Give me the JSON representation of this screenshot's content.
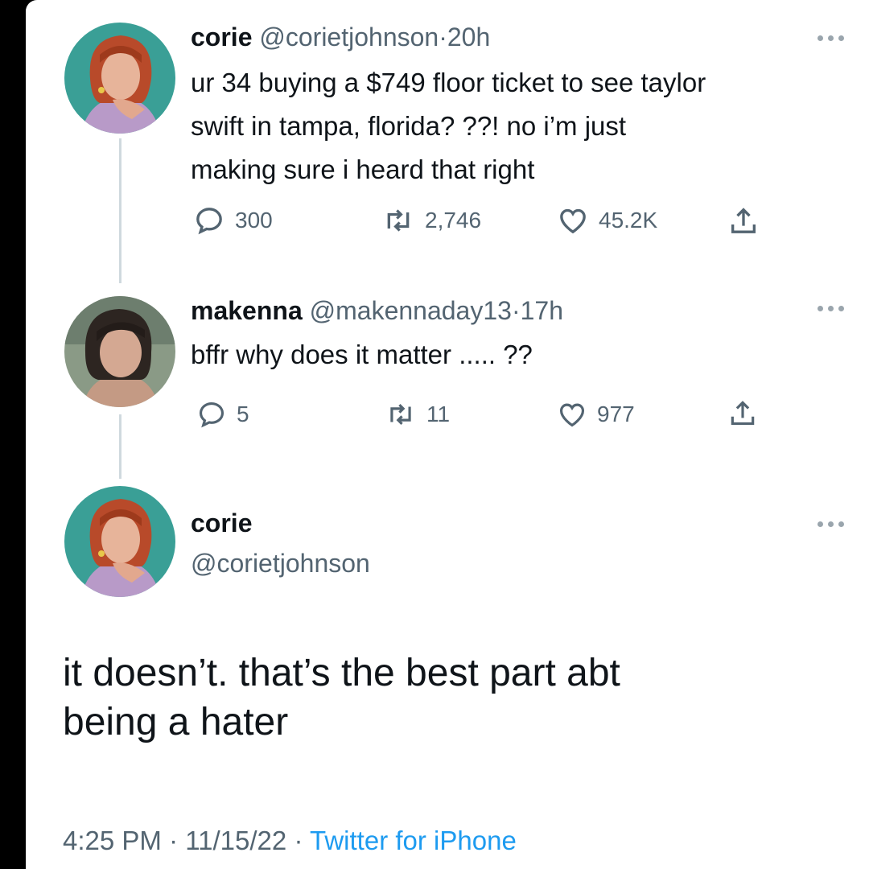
{
  "tweet1": {
    "name": "corie",
    "handle": "@corietjohnson",
    "separator": "·",
    "time": "20h",
    "lines": [
      "ur 34 buying a $749 floor ticket to see taylor",
      "swift in tampa, florida? ??! no i’m just",
      "making sure i heard that right"
    ],
    "replies": "300",
    "retweets": "2,746",
    "likes": "45.2K"
  },
  "tweet2": {
    "name": "makenna",
    "handle": "@makennaday13",
    "separator": "·",
    "time": "17h",
    "lines": [
      "bffr why does it matter ..... ??"
    ],
    "replies": "5",
    "retweets": "11",
    "likes": "977"
  },
  "main_tweet": {
    "name": "corie",
    "handle": "@corietjohnson",
    "lines": [
      "it doesn’t. that’s the best part abt",
      "being a hater"
    ],
    "time": "4:25 PM",
    "separator": "·",
    "date": "11/15/22",
    "separator2": "·",
    "source": "Twitter for iPhone"
  },
  "icons": {
    "reply": "reply-icon",
    "retweet": "retweet-icon",
    "like": "heart-icon",
    "share": "share-icon",
    "more": "more-icon"
  },
  "colors": {
    "text": "#0f1419",
    "secondary": "#536471",
    "link": "#1d9bf0"
  }
}
